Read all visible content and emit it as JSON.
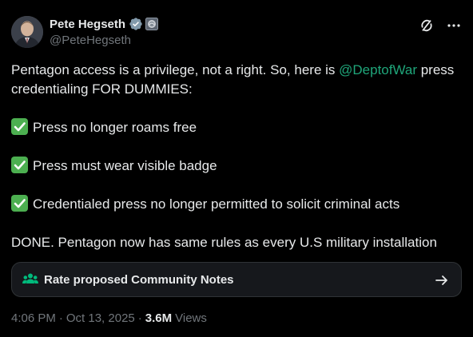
{
  "author": {
    "display_name": "Pete Hegseth",
    "handle": "@PeteHegseth"
  },
  "tweet": {
    "line1_before": "Pentagon access is a privilege, not a right. So, here is ",
    "mention": "@DeptofWar",
    "line1_after": " press credentialing FOR DUMMIES:",
    "items": [
      "Press no longer roams free",
      "Press must wear visible badge",
      "Credentialed press no longer permitted to solicit criminal acts"
    ],
    "closing": "DONE. Pentagon now has same rules as every U.S military installation"
  },
  "community_notes": {
    "label": "Rate proposed Community Notes"
  },
  "meta": {
    "time": "4:06 PM",
    "date": "Oct 13, 2025",
    "separator": "·",
    "views_count": "3.6M",
    "views_label": "Views"
  },
  "colors": {
    "mention": "#1fa67a",
    "check_green": "#4caf50",
    "verified_blue": "#1d9bf0",
    "community_green": "#00ba7c"
  }
}
